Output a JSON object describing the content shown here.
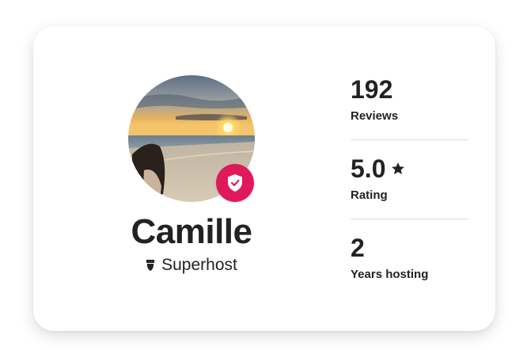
{
  "host": {
    "name": "Camille",
    "superhost_label": "Superhost"
  },
  "stats": [
    {
      "value": "192",
      "label": "Reviews"
    },
    {
      "value": "5.0",
      "label": "Rating"
    },
    {
      "value": "2",
      "label": "Years hosting"
    }
  ],
  "icons": {
    "verified_badge": "shield-check-icon",
    "superhost": "superhost-icon",
    "rating": "star-icon"
  },
  "colors": {
    "badge": "#e0195a",
    "text": "#222222",
    "divider": "#dddddd"
  }
}
